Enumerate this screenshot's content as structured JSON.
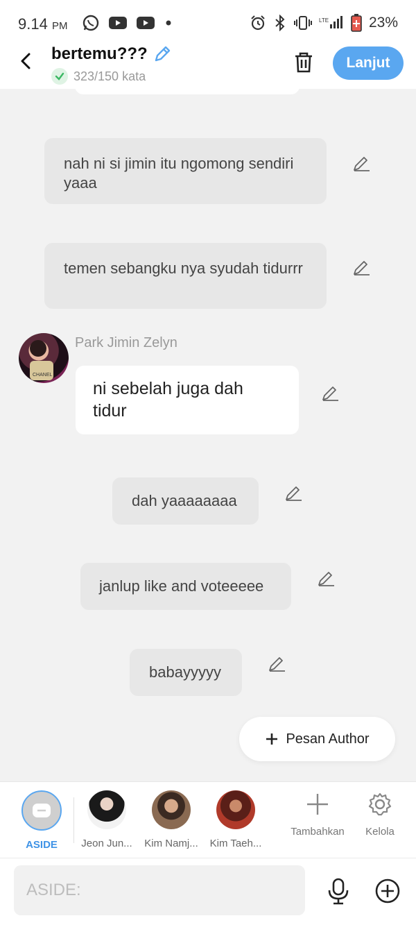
{
  "status_bar": {
    "time": "9.14",
    "ampm": "PM",
    "battery": "23%",
    "left_icons": [
      "whatsapp-icon",
      "youtube-icon",
      "youtube-icon",
      "dot-icon"
    ],
    "right_icons": [
      "alarm-icon",
      "bluetooth-icon",
      "vibrate-icon",
      "signal-icon",
      "battery-icon"
    ]
  },
  "header": {
    "title": "bertemu???",
    "word_count": "323/150 kata",
    "next_label": "Lanjut"
  },
  "messages": [
    {
      "text": "nah ni si jimin itu ngomong sendiri yaaa",
      "style": "aside"
    },
    {
      "text": "temen sebangku nya syudah tidurrr",
      "style": "aside"
    },
    {
      "sender": "Park Jimin Zelyn",
      "text": "ni sebelah juga dah tidur",
      "style": "character"
    },
    {
      "text": "dah yaaaaaaaa",
      "style": "aside"
    },
    {
      "text": "janlup like and voteeeee",
      "style": "aside"
    },
    {
      "text": "babayyyyy",
      "style": "aside"
    }
  ],
  "author_button": "Pesan Author",
  "characters": [
    {
      "label": "ASIDE",
      "active": true
    },
    {
      "label": "Jeon Jun..."
    },
    {
      "label": "Kim Namj..."
    },
    {
      "label": "Kim Taeh..."
    }
  ],
  "tools": {
    "add_label": "Tambahkan",
    "manage_label": "Kelola"
  },
  "input": {
    "placeholder": "ASIDE:"
  },
  "colors": {
    "accent": "#5aa7f0",
    "aside_bubble": "#e7e7e7",
    "background": "#f2f2f2"
  }
}
